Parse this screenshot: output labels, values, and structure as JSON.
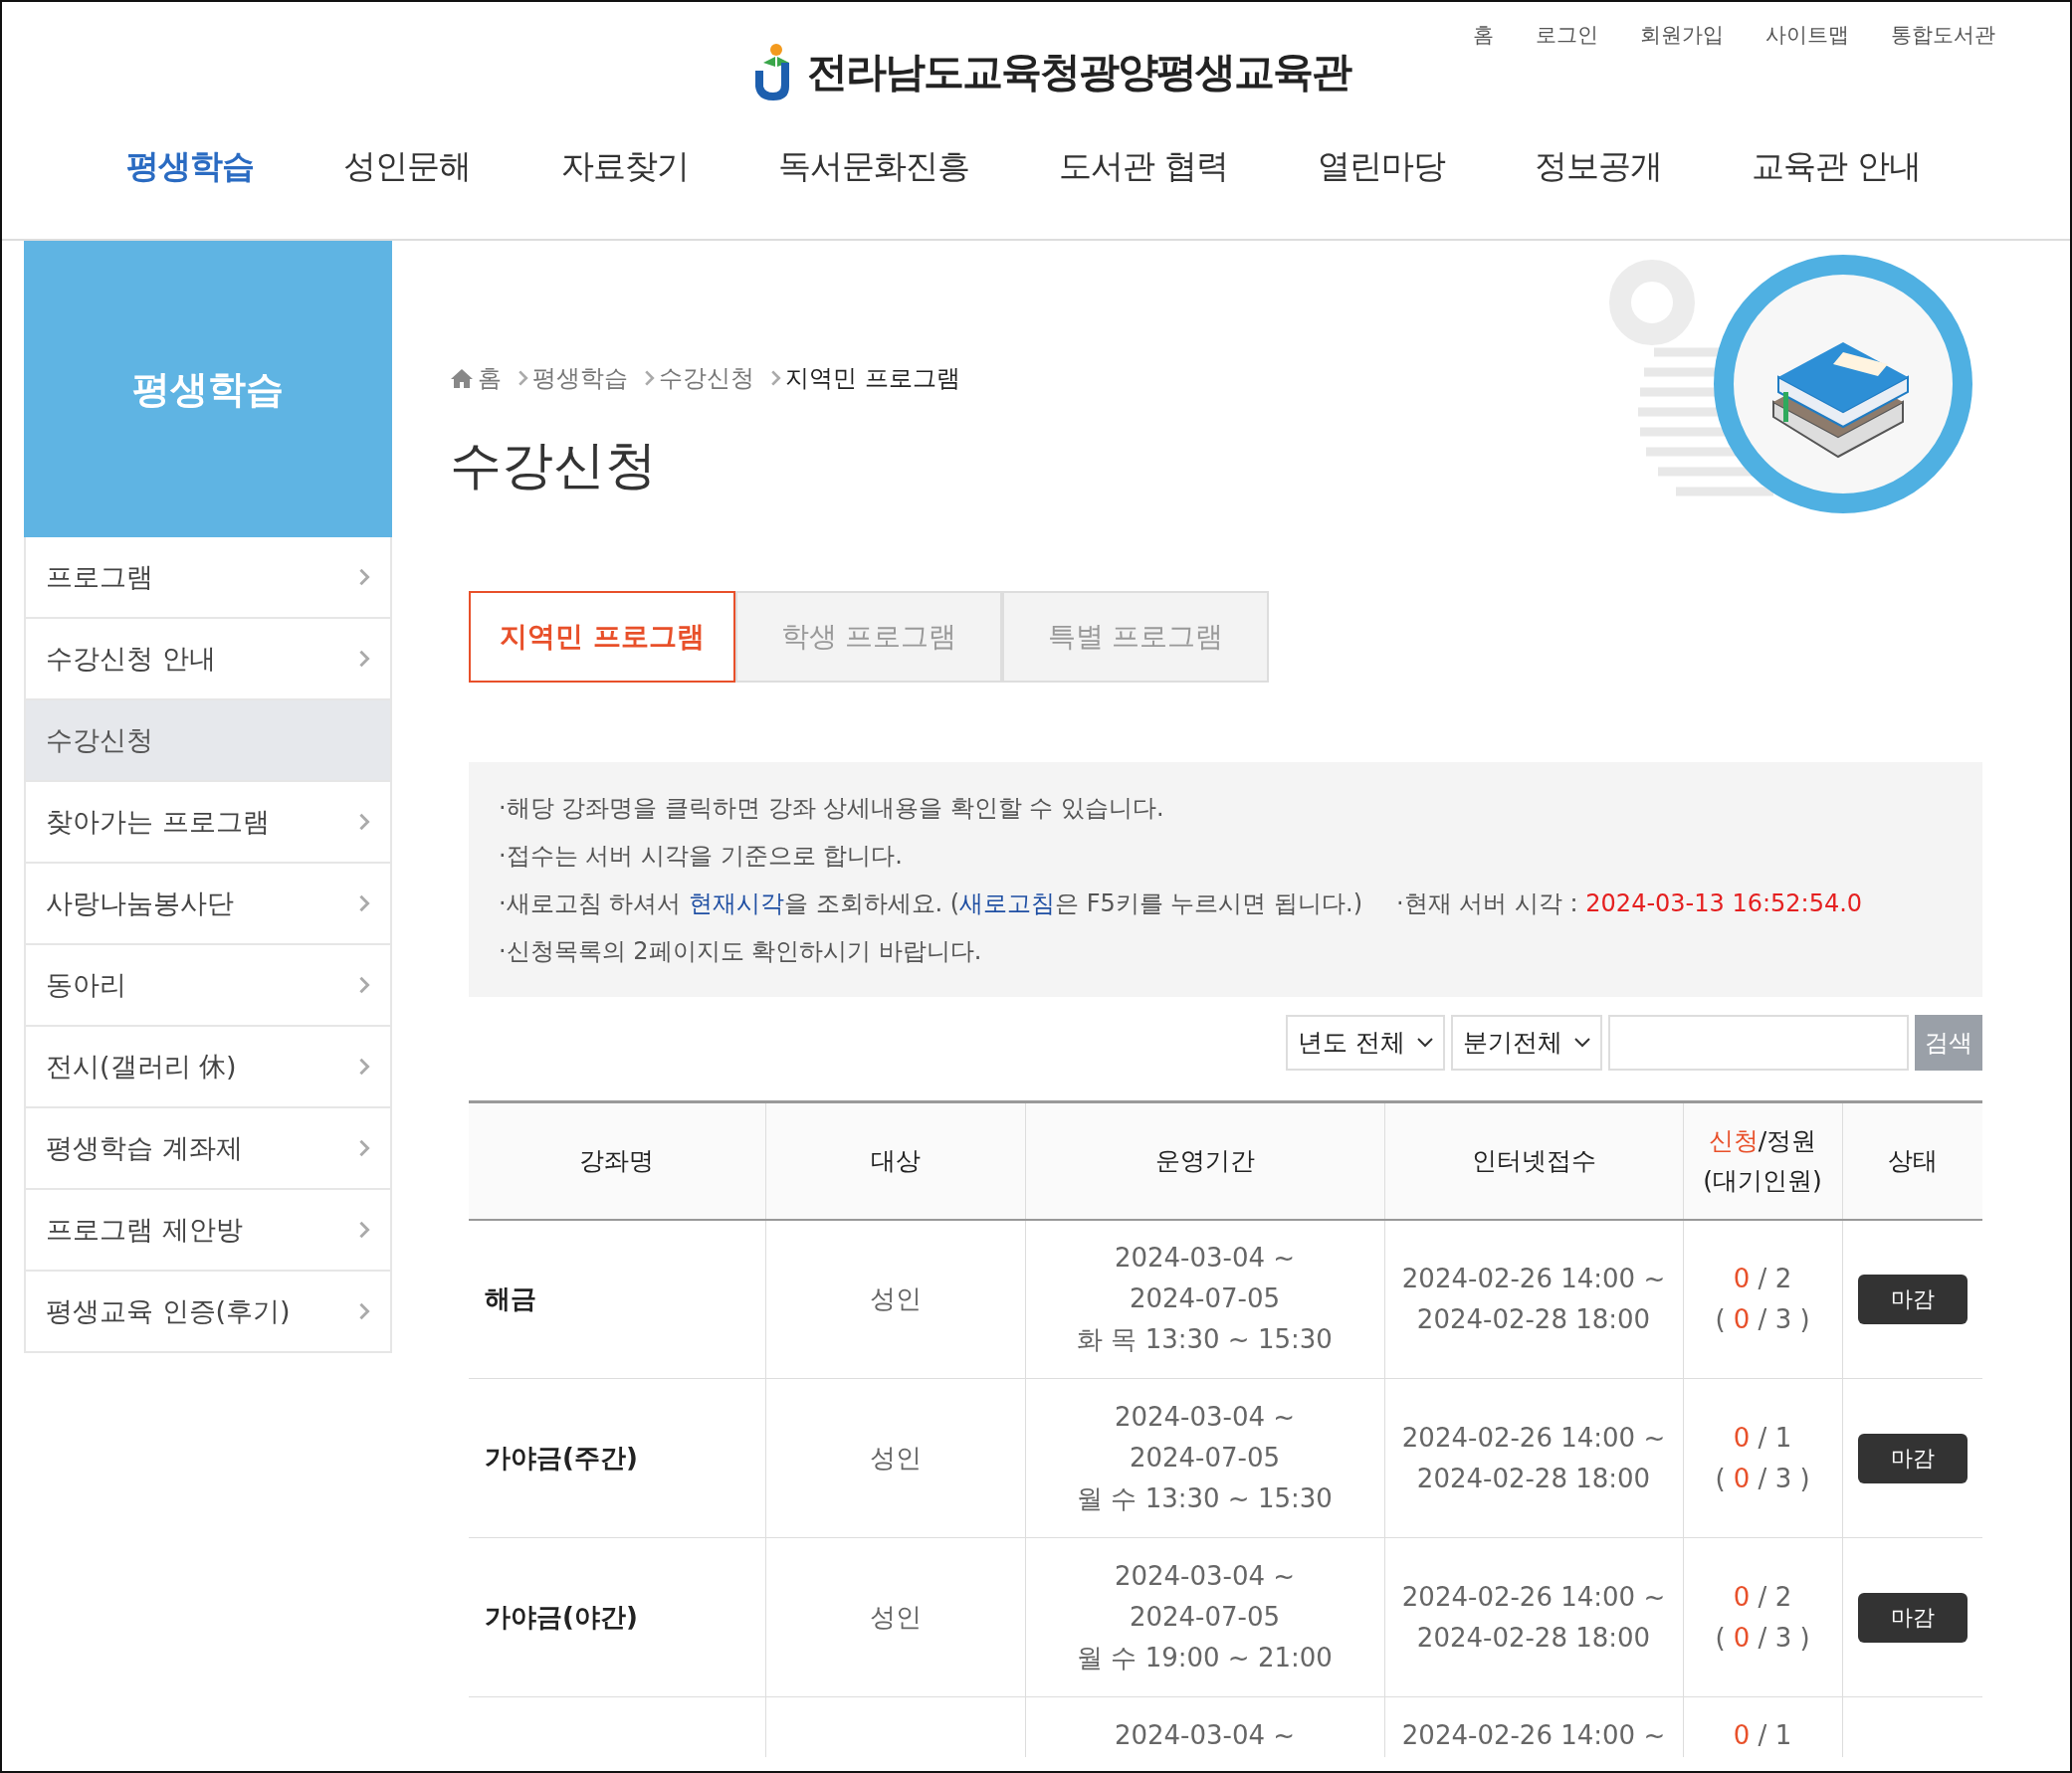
{
  "top_links": [
    {
      "label": "홈"
    },
    {
      "label": "로그인"
    },
    {
      "label": "회원가입"
    },
    {
      "label": "사이트맵"
    },
    {
      "label": "통합도서관"
    }
  ],
  "logo": {
    "text": "전라남도교육청광양평생교육관"
  },
  "nav": [
    {
      "label": "평생학습",
      "selected": true
    },
    {
      "label": "성인문해",
      "selected": false
    },
    {
      "label": "자료찾기",
      "selected": false
    },
    {
      "label": "독서문화진흥",
      "selected": false
    },
    {
      "label": "도서관 협력",
      "selected": false
    },
    {
      "label": "열린마당",
      "selected": false
    },
    {
      "label": "정보공개",
      "selected": false
    },
    {
      "label": "교육관 안내",
      "selected": false
    }
  ],
  "sidebar": {
    "title": "평생학습",
    "items": [
      {
        "label": "프로그램",
        "selected": false
      },
      {
        "label": "수강신청 안내",
        "selected": false
      },
      {
        "label": "수강신청",
        "selected": true
      },
      {
        "label": "찾아가는 프로그램",
        "selected": false
      },
      {
        "label": "사랑나눔봉사단",
        "selected": false
      },
      {
        "label": "동아리",
        "selected": false
      },
      {
        "label": "전시(갤러리 休)",
        "selected": false
      },
      {
        "label": "평생학습 계좌제",
        "selected": false
      },
      {
        "label": "프로그램 제안방",
        "selected": false
      },
      {
        "label": "평생교육 인증(후기)",
        "selected": false
      }
    ]
  },
  "breadcrumb": [
    "홈",
    "평생학습",
    "수강신청",
    "지역민 프로그램"
  ],
  "page_title": "수강신청",
  "tabs": [
    {
      "label": "지역민 프로그램",
      "selected": true
    },
    {
      "label": "학생 프로그램",
      "selected": false
    },
    {
      "label": "특별 프로그램",
      "selected": false
    }
  ],
  "notices": [
    [
      {
        "kind": "plain",
        "text": "·해당 강좌명을 클릭하면 강좌 상세내용을 확인할 수 있습니다."
      }
    ],
    [
      {
        "kind": "plain",
        "text": "·접수는 서버 시각을 기준으로 합니다."
      }
    ],
    [
      {
        "kind": "plain",
        "text": "·새로고침 하셔서 "
      },
      {
        "kind": "link",
        "text": "현재시각"
      },
      {
        "kind": "plain",
        "text": "을 조회하세요. ("
      },
      {
        "kind": "link",
        "text": "새로고침"
      },
      {
        "kind": "plain",
        "text": "은 F5키를 누르시면 됩니다.)"
      },
      {
        "kind": "gap",
        "text": "·현재 서버 시각 : "
      },
      {
        "kind": "time",
        "text": "2024-03-13 16:52:54.0"
      }
    ],
    [
      {
        "kind": "plain",
        "text": "·신청목록의 2페이지도 확인하시기 바랍니다."
      }
    ]
  ],
  "filters": [
    {
      "value": "년도 전체"
    },
    {
      "value": "분기전체"
    }
  ],
  "search": {
    "button": "검색"
  },
  "table": {
    "columns": [
      {
        "parts": [
          {
            "kind": "plain",
            "text": "강좌명"
          }
        ]
      },
      {
        "parts": [
          {
            "kind": "plain",
            "text": "대상"
          }
        ]
      },
      {
        "parts": [
          {
            "kind": "plain",
            "text": "운영기간"
          }
        ]
      },
      {
        "parts": [
          {
            "kind": "plain",
            "text": "인터넷접수"
          }
        ]
      },
      {
        "parts": [
          {
            "kind": "accent",
            "text": "신청"
          },
          {
            "kind": "plain",
            "text": "/정원"
          }
        ],
        "sub": "(대기인원)"
      },
      {
        "parts": [
          {
            "kind": "plain",
            "text": "상태"
          }
        ]
      }
    ],
    "rows": [
      {
        "course": "해금",
        "target": "성인",
        "period": [
          "2024-03-04 ~",
          "2024-07-05",
          "화 목 13:30 ~ 15:30"
        ],
        "reception": [
          "2024-02-26 14:00 ~",
          "2024-02-28 18:00"
        ],
        "count": [
          {
            "kind": "accent",
            "text": "0"
          },
          {
            "kind": "plain",
            "text": " / 2"
          }
        ],
        "waiting": [
          {
            "kind": "plain",
            "text": "( "
          },
          {
            "kind": "accent",
            "text": "0"
          },
          {
            "kind": "plain",
            "text": " / 3 )"
          }
        ],
        "status": "마감"
      },
      {
        "course": "가야금(주간)",
        "target": "성인",
        "period": [
          "2024-03-04 ~",
          "2024-07-05",
          "월 수 13:30 ~ 15:30"
        ],
        "reception": [
          "2024-02-26 14:00 ~",
          "2024-02-28 18:00"
        ],
        "count": [
          {
            "kind": "accent",
            "text": "0"
          },
          {
            "kind": "plain",
            "text": " / 1"
          }
        ],
        "waiting": [
          {
            "kind": "plain",
            "text": "( "
          },
          {
            "kind": "accent",
            "text": "0"
          },
          {
            "kind": "plain",
            "text": " / 3 )"
          }
        ],
        "status": "마감"
      },
      {
        "course": "가야금(야간)",
        "target": "성인",
        "period": [
          "2024-03-04 ~",
          "2024-07-05",
          "월 수 19:00 ~ 21:00"
        ],
        "reception": [
          "2024-02-26 14:00 ~",
          "2024-02-28 18:00"
        ],
        "count": [
          {
            "kind": "accent",
            "text": "0"
          },
          {
            "kind": "plain",
            "text": " / 2"
          }
        ],
        "waiting": [
          {
            "kind": "plain",
            "text": "( "
          },
          {
            "kind": "accent",
            "text": "0"
          },
          {
            "kind": "plain",
            "text": " / 3 )"
          }
        ],
        "status": "마감"
      },
      {
        "period": [
          "2024-03-04 ~"
        ],
        "reception": [
          "2024-02-26 14:00 ~"
        ],
        "count": [
          {
            "kind": "accent",
            "text": "0"
          },
          {
            "kind": "plain",
            "text": " / 1"
          }
        ]
      }
    ]
  }
}
